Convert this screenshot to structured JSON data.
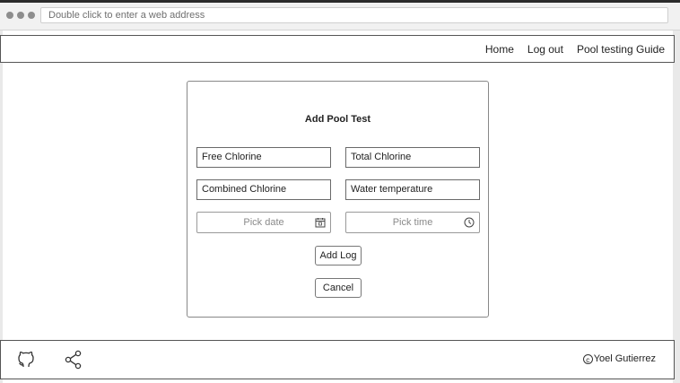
{
  "browser": {
    "address_placeholder": "Double click to enter a web address"
  },
  "nav": {
    "links": [
      "Home",
      "Log out",
      "Pool testing Guide"
    ]
  },
  "form": {
    "title": "Add Pool Test",
    "fields": {
      "free_chlorine": "Free Chlorine",
      "total_chlorine": "Total Chlorine",
      "combined_chlorine": "Combined Chlorine",
      "water_temperature": "Water temperature"
    },
    "date_placeholder": "Pick date",
    "time_placeholder": "Pick time",
    "add_button": "Add Log",
    "cancel_button": "Cancel"
  },
  "footer": {
    "icons": [
      "github-icon",
      "share-icon"
    ],
    "copyright_symbol": "c",
    "author": "Yoel Gutierrez"
  }
}
